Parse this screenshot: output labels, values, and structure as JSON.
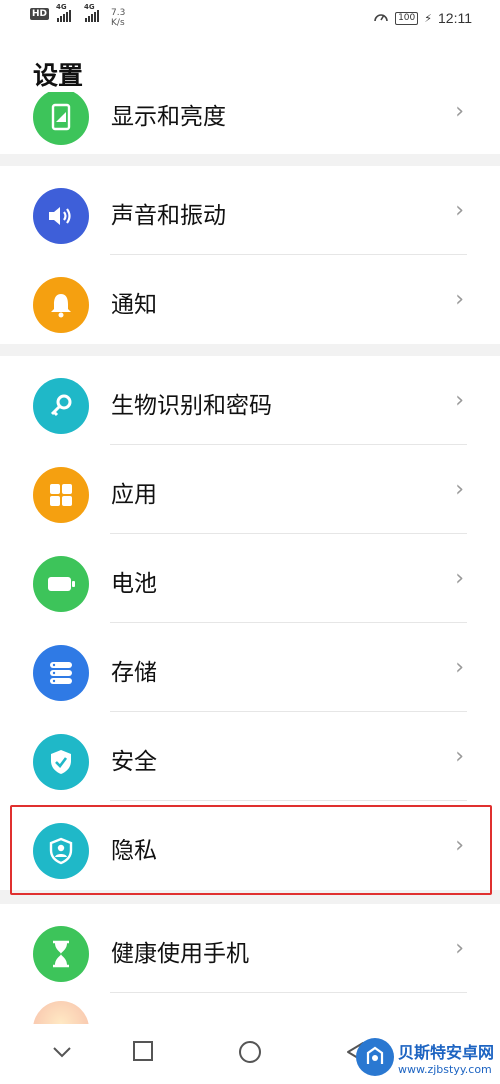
{
  "status_bar": {
    "hd_badge": "HD",
    "net1": "4G",
    "net2": "4G",
    "speed_value": "7.3",
    "speed_unit": "K/s",
    "battery": "100",
    "time": "12:11"
  },
  "page": {
    "title": "设置"
  },
  "items": [
    {
      "label": "显示和亮度",
      "icon": "display-icon",
      "color": "#3dc45a"
    },
    {
      "label": "声音和振动",
      "icon": "speaker-icon",
      "color": "#3e5fd9"
    },
    {
      "label": "通知",
      "icon": "bell-icon",
      "color": "#f5a010"
    },
    {
      "label": "生物识别和密码",
      "icon": "key-icon",
      "color": "#1fb8c8"
    },
    {
      "label": "应用",
      "icon": "apps-grid-icon",
      "color": "#f5a010"
    },
    {
      "label": "电池",
      "icon": "battery-icon",
      "color": "#3dc45a"
    },
    {
      "label": "存储",
      "icon": "storage-icon",
      "color": "#2f7ae5"
    },
    {
      "label": "安全",
      "icon": "shield-check-icon",
      "color": "#1fb8c8"
    },
    {
      "label": "隐私",
      "icon": "privacy-shield-icon",
      "color": "#1fb8c8"
    },
    {
      "label": "健康使用手机",
      "icon": "hourglass-icon",
      "color": "#3dc45a"
    }
  ],
  "watermark": {
    "name": "贝斯特安卓网",
    "url": "www.zjbstyy.com"
  }
}
